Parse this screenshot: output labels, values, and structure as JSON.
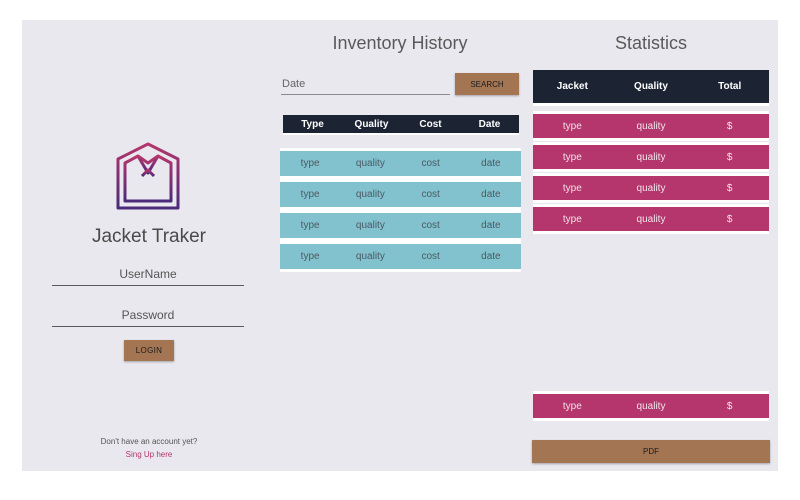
{
  "login": {
    "app_title": "Jacket Traker",
    "username_placeholder": "UserName",
    "password_placeholder": "Password",
    "login_label": "LOGIN",
    "signup_question": "Don't have an account yet?",
    "signup_link": "Sing Up here",
    "logo_icon": "jacket-icon"
  },
  "inventory": {
    "title": "Inventory History",
    "date_placeholder": "Date",
    "search_label": "SEARCH",
    "columns": [
      "Type",
      "Quality",
      "Cost",
      "Date"
    ],
    "rows": [
      [
        "type",
        "quality",
        "cost",
        "date"
      ],
      [
        "type",
        "quality",
        "cost",
        "date"
      ],
      [
        "type",
        "quality",
        "cost",
        "date"
      ],
      [
        "type",
        "quality",
        "cost",
        "date"
      ]
    ]
  },
  "statistics": {
    "title": "Statistics",
    "columns": [
      "Jacket",
      "Quality",
      "Total"
    ],
    "rows": [
      [
        "type",
        "quality",
        "$"
      ],
      [
        "type",
        "quality",
        "$"
      ],
      [
        "type",
        "quality",
        "$"
      ],
      [
        "type",
        "quality",
        "$"
      ]
    ],
    "total_row": [
      "type",
      "quality",
      "$"
    ],
    "pdf_label": "PDF"
  },
  "colors": {
    "background": "#e8e8ee",
    "accent_button": "#a37553",
    "header_dark": "#1c2434",
    "inventory_row": "#82c2ce",
    "statistics_row": "#b5366c"
  }
}
